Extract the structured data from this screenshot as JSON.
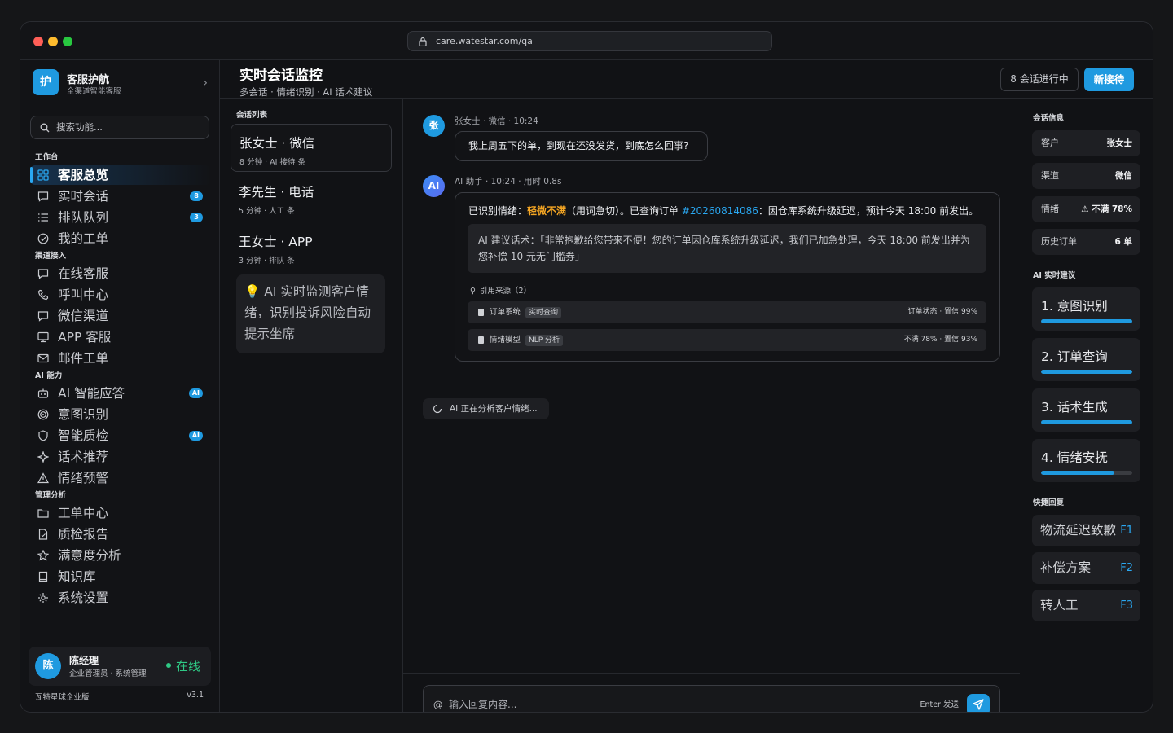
{
  "window": {
    "url": "care.watestar.com/qa",
    "dots": [
      "#ff5f57",
      "#febc2e",
      "#28c840"
    ]
  },
  "brand": {
    "logo": "护",
    "name": "客服护航",
    "subtitle": "全渠道智能客服"
  },
  "search": {
    "placeholder": "搜索功能..."
  },
  "sidebar": {
    "sections": [
      "工作台",
      "渠道接入",
      "AI 能力",
      "管理分析"
    ],
    "items": [
      {
        "label": "客服总览",
        "icon": "grid-icon",
        "active": true
      },
      {
        "label": "实时会话",
        "icon": "chat-icon",
        "badge": "8"
      },
      {
        "label": "排队队列",
        "icon": "list-icon",
        "badge": "3"
      },
      {
        "label": "我的工单",
        "icon": "check-circle-icon"
      },
      {
        "label": "在线客服",
        "icon": "chat-icon"
      },
      {
        "label": "呼叫中心",
        "icon": "phone-icon"
      },
      {
        "label": "微信渠道",
        "icon": "chat-icon"
      },
      {
        "label": "APP 客服",
        "icon": "monitor-icon"
      },
      {
        "label": "邮件工单",
        "icon": "mail-icon"
      },
      {
        "label": "AI 智能应答",
        "icon": "robot-icon",
        "badge": "AI"
      },
      {
        "label": "意图识别",
        "icon": "target-icon"
      },
      {
        "label": "智能质检",
        "icon": "shield-icon",
        "badge": "AI"
      },
      {
        "label": "话术推荐",
        "icon": "sparkle-icon"
      },
      {
        "label": "情绪预警",
        "icon": "warning-icon"
      },
      {
        "label": "工单中心",
        "icon": "folder-icon"
      },
      {
        "label": "质检报告",
        "icon": "file-icon"
      },
      {
        "label": "满意度分析",
        "icon": "star-icon"
      },
      {
        "label": "知识库",
        "icon": "book-icon"
      },
      {
        "label": "系统设置",
        "icon": "gear-icon"
      }
    ]
  },
  "user": {
    "avatar": "陈",
    "name": "陈经理",
    "role": "企业管理员 · 系统管理",
    "status": "在线"
  },
  "footer": {
    "edition": "瓦特星球企业版",
    "version": "v3.1"
  },
  "header": {
    "title": "实时会话监控",
    "subtitle": "多会话 · 情绪识别 · AI 话术建议",
    "count": "8 会话进行中",
    "new_button": "新接待"
  },
  "conversations": {
    "title": "会话列表",
    "items": [
      {
        "name": "张女士 · 微信",
        "meta": "8 分钟 · AI 接待 条"
      },
      {
        "name": "李先生 · 电话",
        "meta": "5 分钟 · 人工 条"
      },
      {
        "name": "王女士 · APP",
        "meta": "3 分钟 · 排队 条"
      }
    ],
    "tip": "💡 AI 实时监测客户情绪，识别投诉风险自动提示坐席"
  },
  "chat": {
    "customer": {
      "avatar": "张",
      "meta": "张女士 · 微信 · 10:24",
      "text": "我上周五下的单，到现在还没发货，到底怎么回事?"
    },
    "ai": {
      "avatar": "AI",
      "meta": "AI 助手 · 10:24 · 用时 0.8s",
      "line_prefix": "已识别情绪：",
      "emotion": "轻微不满",
      "line_mid": "（用词急切）。已查询订单 ",
      "order": "#20260814086",
      "line_suffix": "：因仓库系统升级延迟，预计今天 18:00 前发出。",
      "suggestion": "AI 建议话术：「非常抱歉给您带来不便！您的订单因仓库系统升级延迟，我们已加急处理，今天 18:00 前发出并为您补偿 10 元无门槛券」",
      "citations_title": "引用来源（2）",
      "citations": [
        {
          "source": "订单系统",
          "tag": "实时查询",
          "result": "订单状态 · 置信 99%"
        },
        {
          "source": "情绪模型",
          "tag": "NLP 分析",
          "result": "不满 78% · 置信 93%"
        }
      ]
    },
    "analyzing": "AI 正在分析客户情绪...",
    "input": {
      "placeholder": "输入回复内容...",
      "at": "@",
      "hint": "Enter 发送"
    }
  },
  "session_info": {
    "title": "会话信息",
    "rows": [
      {
        "label": "客户",
        "value": "张女士"
      },
      {
        "label": "渠道",
        "value": "微信"
      },
      {
        "label": "情绪",
        "value": "⚠ 不满 78%"
      },
      {
        "label": "历史订单",
        "value": "6 单"
      }
    ]
  },
  "suggestions": {
    "title": "AI 实时建议",
    "items": [
      {
        "label": "1. 意图识别",
        "progress": 1.0
      },
      {
        "label": "2. 订单查询",
        "progress": 1.0
      },
      {
        "label": "3. 话术生成",
        "progress": 1.0
      },
      {
        "label": "4. 情绪安抚",
        "progress": 0.8
      }
    ]
  },
  "quick_replies": {
    "title": "快捷回复",
    "items": [
      {
        "label": "物流延迟致歉",
        "key": "F1"
      },
      {
        "label": "补偿方案",
        "key": "F2"
      },
      {
        "label": "转人工",
        "key": "F3"
      }
    ]
  },
  "colors": {
    "accent": "#1f9ae0",
    "warning": "#f5a623",
    "success": "#2fc985"
  }
}
